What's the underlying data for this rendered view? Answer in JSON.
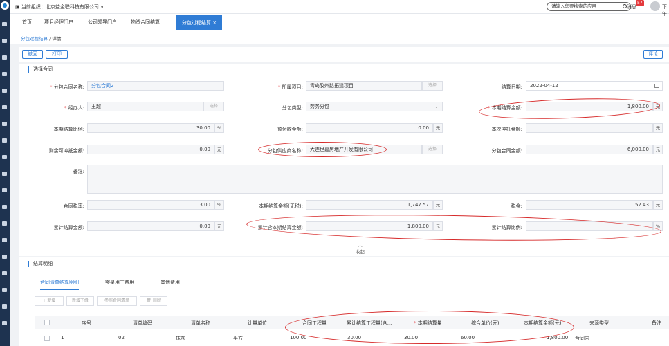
{
  "topbar": {
    "org_label": "当前组织：北京益企联科技有限公司",
    "search_placeholder": "请输入您要搜索的应用",
    "messages_label": "消息",
    "messages_count": "57",
    "user_label": "下午"
  },
  "tabs": [
    {
      "label": "首页"
    },
    {
      "label": "项目经理门户"
    },
    {
      "label": "公司领导门户"
    },
    {
      "label": "物资合同结算"
    },
    {
      "label": "分包过程结算",
      "close": "×"
    }
  ],
  "breadcrumb": {
    "parent": "分包过程结算",
    "sep": "/",
    "current": "详情"
  },
  "toolbar": {
    "withdraw_label": "撤回",
    "print_label": "打印",
    "comment_label": "评论"
  },
  "section1": {
    "title": "选择合同"
  },
  "form": {
    "contract_name_label": "分包合同名称:",
    "contract_name_value": "分包合同2",
    "project_label": "所属项目:",
    "project_value": "青岛胶州路拓建项目",
    "settle_date_label": "结算日期:",
    "settle_date_value": "2022-04-12",
    "handler_label": "经办人:",
    "handler_value": "王超",
    "sub_type_label": "分包类型:",
    "sub_type_value": "劳务分包",
    "period_amount_label": "本期结算金额:",
    "period_amount_value": "1,800.00",
    "period_ratio_label": "本期结算比例:",
    "period_ratio_value": "30.00",
    "prepay_label": "预付款金额:",
    "prepay_value": "0.00",
    "offset_label": "本次冲抵金额:",
    "offset_value": "",
    "remain_offset_label": "剩余可冲抵金额:",
    "remain_offset_value": "0.00",
    "supplier_label": "分包供应商名称:",
    "supplier_value": "大连世嘉房地产开发有限公司",
    "contract_amount_label": "分包合同金额:",
    "contract_amount_value": "6,000.00",
    "remark_label": "备注:",
    "tax_rate_label": "合同税率:",
    "tax_rate_value": "3.00",
    "period_notax_label": "本期结算金额(无税):",
    "period_notax_value": "1,747.57",
    "tax_label": "税金:",
    "tax_value": "52.43",
    "cum_amount_label": "累计结算金额:",
    "cum_amount_value": "0.00",
    "cum_incl_label": "累计含本期结算金额:",
    "cum_incl_value": "1,800.00",
    "cum_ratio_label": "累计结算比例:",
    "cum_ratio_value": "",
    "unit_yuan": "元",
    "unit_pct": "%",
    "pick_label": "选择",
    "collapse_label": "收起"
  },
  "section2": {
    "title": "结算明细",
    "subtabs": [
      {
        "label": "合同清单结算明细"
      },
      {
        "label": "零星用工费用"
      },
      {
        "label": "其他费用"
      }
    ],
    "buttons": [
      {
        "label": "+ 新增"
      },
      {
        "label": "新增下级"
      },
      {
        "label": "参照合同清单"
      },
      {
        "label": "删除"
      }
    ]
  },
  "table": {
    "headers": [
      "序号",
      "清单编码",
      "清单名称",
      "计量单位",
      "合同工程量",
      "累计结算工程量(含...",
      "本期结算量",
      "综合单价(元)",
      "本期结算金额(元)",
      "来源类型",
      "备注"
    ],
    "rows": [
      {
        "seq": "1",
        "code": "02",
        "name": "抹灰",
        "unit": "平方",
        "qty": "100.00",
        "cum_qty": "30.00",
        "period_qty": "30.00",
        "price": "60.00",
        "amount": "1,800.00",
        "source": "合同内",
        "remark": ""
      }
    ]
  },
  "colors": {
    "accent": "#2f7cd5",
    "annotation": "#d62a2a",
    "sidebar": "#1e3350"
  }
}
